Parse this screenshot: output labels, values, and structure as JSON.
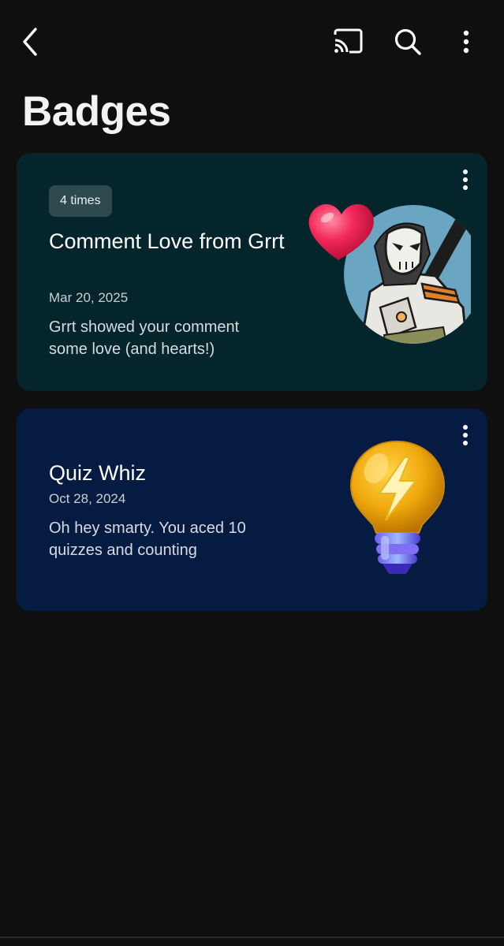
{
  "header": {
    "title": "Badges",
    "icons": [
      "back-arrow-icon",
      "cast-icon",
      "search-icon",
      "more-vert-icon"
    ]
  },
  "badges": [
    {
      "times": "4 times",
      "title": "Comment Love from Grrt",
      "date": "Mar 20, 2025",
      "description": "Grrt showed your comment some love (and hearts!)",
      "background": "#03252b",
      "image_icon": "heart-avatar-icon"
    },
    {
      "title": "Quiz Whiz",
      "date": "Oct 28, 2024",
      "description": "Oh hey smarty. You aced 10 quizzes and counting",
      "background": "#061b42",
      "image_icon": "lightbulb-bolt-icon"
    }
  ],
  "colors": {
    "page_background": "#0f0f0f",
    "chip_background": "#2f4a4e"
  }
}
